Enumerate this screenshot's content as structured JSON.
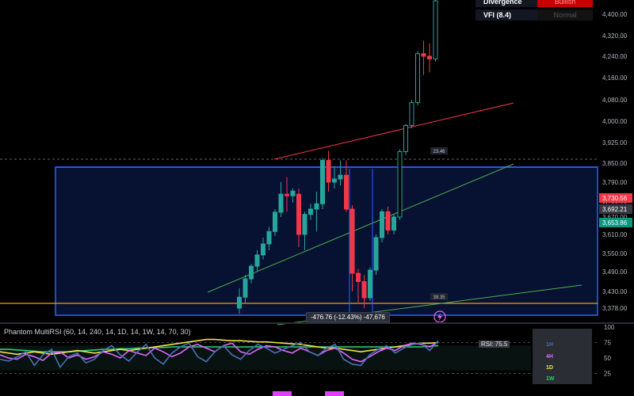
{
  "info_table": {
    "rows": [
      {
        "label": "Divergence",
        "value": "Bullish"
      },
      {
        "label": "VFI (8.4)",
        "value": "Normal"
      }
    ]
  },
  "indicator": {
    "title": "Phantom MultiRSI (60, 14, 240, 14, 1D, 14, 1W, 14, 70, 30)",
    "badge": "RSI: 75.5",
    "timeframes": [
      {
        "label": "1H",
        "color": "#4a6fb3"
      },
      {
        "label": "4H",
        "color": "#e066ff"
      },
      {
        "label": "1D",
        "color": "#f0e442"
      },
      {
        "label": "1W",
        "color": "#2ecc71"
      }
    ],
    "levels": [
      100,
      75,
      50,
      25
    ],
    "colors": {
      "1H": "#4a6fb3",
      "4H": "#e066ff",
      "1D": "#f0e442",
      "1W": "#2ecc71"
    }
  },
  "measure_label": "-476.76 (-12.43%) -47,676",
  "box_labels": [
    "23.46",
    "38.35"
  ],
  "price_markers": [
    {
      "value": "3,730.56",
      "bg": "#f23645",
      "fg": "#ffffff"
    },
    {
      "value": "3,692.21",
      "bg": "#363a45",
      "fg": "#ffffff"
    },
    {
      "value": "3,653.86",
      "bg": "#089981",
      "fg": "#ffffff"
    }
  ],
  "chart_data": {
    "type": "candlestick",
    "price_axis": {
      "ticks": [
        4400,
        4320,
        4240,
        4160,
        4080,
        4000,
        3925,
        3850,
        3790,
        3730,
        3670,
        3610,
        3550,
        3490,
        3430,
        3378
      ],
      "labels": [
        "4,400.00",
        "4,320.00",
        "4,240.00",
        "4,160.00",
        "4,080.00",
        "4,000.00",
        "3,925.00",
        "3,850.00",
        "3,790.00",
        "3,730.00",
        "3,670.00",
        "3,610.00",
        "3,550.00",
        "3,490.00",
        "3,430.00",
        "3,378.00"
      ]
    },
    "candles": [
      {
        "o": 3378,
        "h": 3440,
        "l": 3360,
        "c": 3412
      },
      {
        "o": 3412,
        "h": 3480,
        "l": 3395,
        "c": 3468
      },
      {
        "o": 3468,
        "h": 3515,
        "l": 3455,
        "c": 3508
      },
      {
        "o": 3508,
        "h": 3560,
        "l": 3490,
        "c": 3545
      },
      {
        "o": 3545,
        "h": 3600,
        "l": 3530,
        "c": 3580
      },
      {
        "o": 3580,
        "h": 3635,
        "l": 3560,
        "c": 3620
      },
      {
        "o": 3620,
        "h": 3700,
        "l": 3605,
        "c": 3688
      },
      {
        "o": 3688,
        "h": 3790,
        "l": 3670,
        "c": 3752
      },
      {
        "o": 3752,
        "h": 3805,
        "l": 3690,
        "c": 3747
      },
      {
        "o": 3747,
        "h": 3770,
        "l": 3725,
        "c": 3762
      },
      {
        "o": 3752,
        "h": 3770,
        "l": 3570,
        "c": 3610
      },
      {
        "o": 3610,
        "h": 3690,
        "l": 3560,
        "c": 3680
      },
      {
        "o": 3680,
        "h": 3720,
        "l": 3660,
        "c": 3700
      },
      {
        "o": 3700,
        "h": 3760,
        "l": 3620,
        "c": 3720
      },
      {
        "o": 3720,
        "h": 3870,
        "l": 3700,
        "c": 3860
      },
      {
        "o": 3860,
        "h": 3895,
        "l": 3760,
        "c": 3790
      },
      {
        "o": 3790,
        "h": 3840,
        "l": 3770,
        "c": 3800
      },
      {
        "o": 3800,
        "h": 3860,
        "l": 3780,
        "c": 3812
      },
      {
        "o": 3812,
        "h": 3860,
        "l": 3690,
        "c": 3700
      },
      {
        "o": 3700,
        "h": 3715,
        "l": 3430,
        "c": 3485
      },
      {
        "o": 3485,
        "h": 3500,
        "l": 3395,
        "c": 3460
      },
      {
        "o": 3460,
        "h": 3480,
        "l": 3378,
        "c": 3410
      },
      {
        "o": 3410,
        "h": 3505,
        "l": 3400,
        "c": 3495
      },
      {
        "o": 3495,
        "h": 3610,
        "l": 3480,
        "c": 3600
      },
      {
        "o": 3600,
        "h": 3700,
        "l": 3585,
        "c": 3690
      },
      {
        "o": 3690,
        "h": 3710,
        "l": 3610,
        "c": 3625
      },
      {
        "o": 3625,
        "h": 3680,
        "l": 3610,
        "c": 3670
      },
      {
        "o": 3670,
        "h": 3900,
        "l": 3660,
        "c": 3892
      },
      {
        "o": 3892,
        "h": 3990,
        "l": 3880,
        "c": 3985
      },
      {
        "o": 3985,
        "h": 4080,
        "l": 3975,
        "c": 4070
      },
      {
        "o": 4070,
        "h": 4260,
        "l": 4060,
        "c": 4250
      },
      {
        "o": 4250,
        "h": 4300,
        "l": 4170,
        "c": 4240
      },
      {
        "o": 4240,
        "h": 4290,
        "l": 4180,
        "c": 4230
      },
      {
        "o": 4230,
        "h": 4460,
        "l": 4220,
        "c": 4450
      }
    ],
    "rsi_axis": {
      "ticks": [
        100,
        75,
        50,
        25
      ]
    },
    "rsi_series": [
      {
        "name": "1H",
        "values": [
          48,
          45,
          52,
          60,
          38,
          55,
          64,
          35,
          52,
          58,
          42,
          48,
          62,
          70,
          55,
          45,
          60,
          72,
          50,
          40,
          58,
          68,
          74,
          52,
          44,
          60,
          70,
          55,
          48,
          62,
          72,
          66,
          58,
          64,
          70,
          75,
          60,
          54,
          66,
          72,
          48,
          40,
          38,
          55,
          64,
          70,
          58,
          66,
          72,
          74,
          62,
          78
        ]
      },
      {
        "name": "4H",
        "values": [
          55,
          50,
          48,
          56,
          52,
          46,
          58,
          60,
          50,
          55,
          48,
          52,
          60,
          56,
          50,
          62,
          58,
          54,
          66,
          60,
          52,
          58,
          68,
          72,
          66,
          60,
          70,
          74,
          60,
          56,
          64,
          70,
          68,
          62,
          58,
          66,
          60,
          54,
          62,
          66,
          58,
          48,
          44,
          52,
          60,
          66,
          62,
          70,
          74,
          72,
          68,
          76
        ]
      },
      {
        "name": "1D",
        "values": [
          60,
          58,
          56,
          58,
          60,
          58,
          56,
          58,
          60,
          62,
          60,
          58,
          60,
          62,
          64,
          62,
          64,
          66,
          68,
          70,
          72,
          74,
          76,
          78,
          80,
          80,
          79,
          78,
          78,
          77,
          76,
          76,
          75,
          74,
          73,
          72,
          70,
          68,
          66,
          66,
          64,
          62,
          60,
          62,
          64,
          66,
          68,
          70,
          72,
          74,
          74,
          75
        ]
      },
      {
        "name": "1W",
        "values": [
          64,
          64,
          63,
          62,
          61,
          60,
          60,
          60,
          60,
          61,
          62,
          63,
          64,
          64,
          65,
          65,
          66,
          66,
          67,
          67,
          68,
          68,
          68,
          68,
          68,
          68,
          68,
          68,
          68,
          68,
          68,
          68,
          68,
          68,
          68,
          68,
          68,
          68,
          68,
          68,
          68,
          68,
          68,
          68,
          68,
          68,
          68,
          68,
          68,
          68,
          69,
          70
        ]
      }
    ]
  }
}
